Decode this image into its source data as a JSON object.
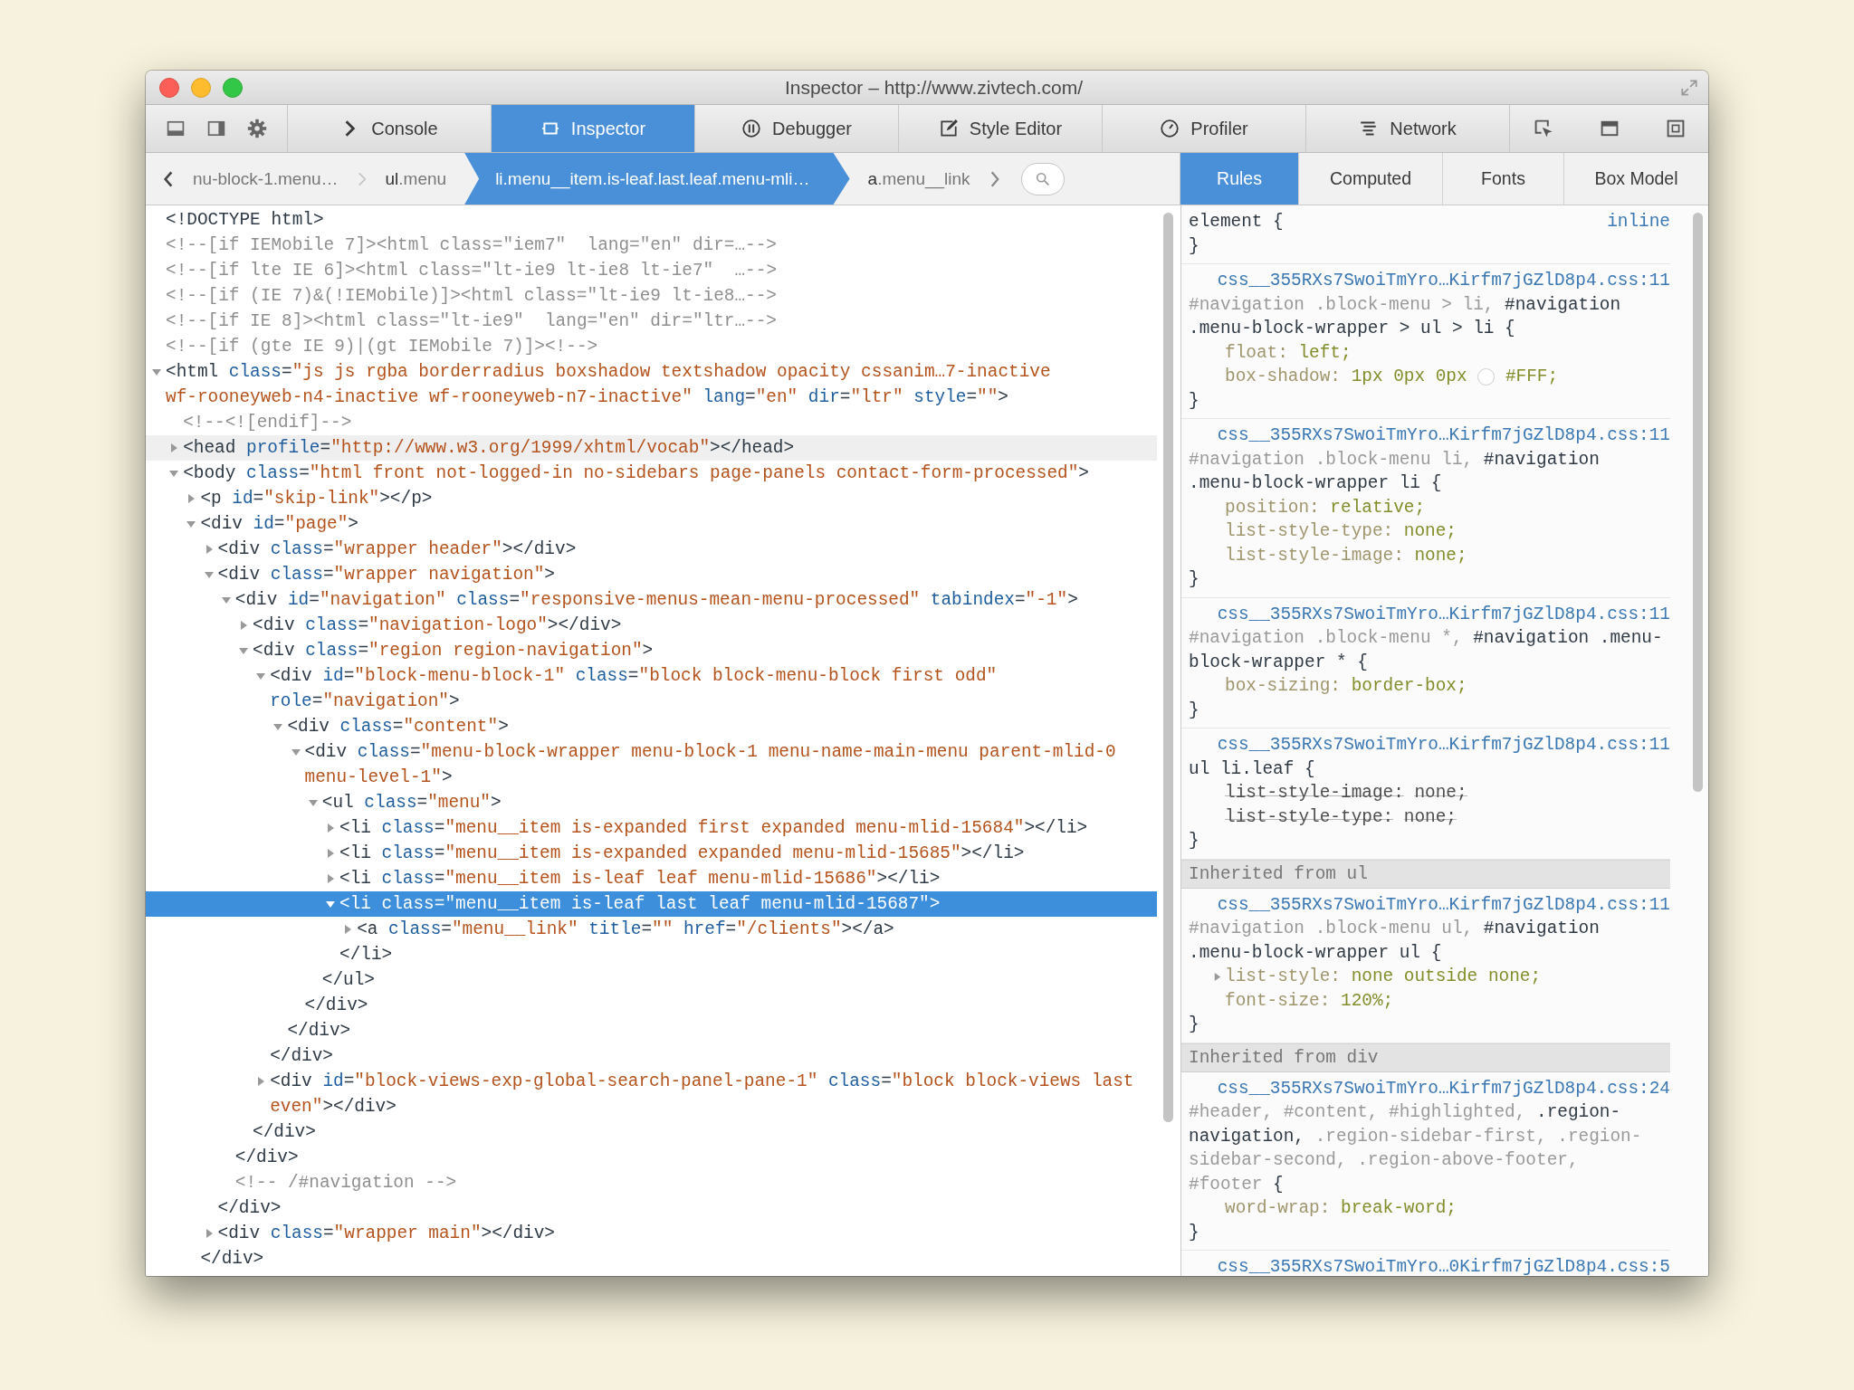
{
  "window": {
    "title": "Inspector – http://www.zivtech.com/"
  },
  "toolbar": {
    "tabs": [
      {
        "label": "Console",
        "selected": false
      },
      {
        "label": "Inspector",
        "selected": true
      },
      {
        "label": "Debugger",
        "selected": false
      },
      {
        "label": "Style Editor",
        "selected": false
      },
      {
        "label": "Profiler",
        "selected": false
      },
      {
        "label": "Network",
        "selected": false
      }
    ]
  },
  "breadcrumbs": [
    {
      "classes": "nu-block-1.menu…",
      "selected": false
    },
    {
      "tag": "ul",
      "classes": ".menu",
      "selected": false
    },
    {
      "tag": "li",
      "classes": ".menu__item.is-leaf.last.leaf.menu-mli…",
      "selected": true
    },
    {
      "tag": "a",
      "classes": ".menu__link",
      "selected": false
    }
  ],
  "side_tabs": [
    {
      "label": "Rules",
      "selected": true
    },
    {
      "label": "Computed",
      "selected": false
    },
    {
      "label": "Fonts",
      "selected": false
    },
    {
      "label": "Box Model",
      "selected": false
    }
  ],
  "markup": [
    {
      "kind": "doctype",
      "text": "<!DOCTYPE html>",
      "selected": false,
      "hovered": false
    },
    {
      "kind": "comment",
      "text": "<!--[if IEMobile 7]><html class=\"iem7\"  lang=\"en\" dir=…-->",
      "selected": false,
      "hovered": false
    },
    {
      "kind": "comment",
      "text": "<!--[if lte IE 6]><html class=\"lt-ie9 lt-ie8 lt-ie7\"  …-->",
      "selected": false,
      "hovered": false
    },
    {
      "kind": "comment",
      "text": "<!--[if (IE 7)&(!IEMobile)]><html class=\"lt-ie9 lt-ie8…-->",
      "selected": false,
      "hovered": false
    },
    {
      "kind": "comment",
      "text": "<!--[if IE 8]><html class=\"lt-ie9\"  lang=\"en\" dir=\"ltr…-->",
      "selected": false,
      "hovered": false
    },
    {
      "kind": "comment",
      "text": "<!--[if (gte IE 9)|(gt IEMobile 7)]><!-->",
      "selected": false,
      "hovered": false
    },
    {
      "kind": "element",
      "text": "<html class=\"js js rgba borderradius boxshadow textshadow opacity cssanim…7-inactive wf-rooneyweb-n4-inactive wf-rooneyweb-n7-inactive\" lang=\"en\" dir=\"ltr\" style=\"\">",
      "expanded": true,
      "selected": false,
      "hovered": false,
      "children": [
        {
          "kind": "comment",
          "text": "<!--<![endif]-->",
          "selected": false,
          "hovered": false
        },
        {
          "kind": "element",
          "text": "<head profile=\"http://www.w3.org/1999/xhtml/vocab\"></head>",
          "expanded": false,
          "selected": false,
          "hovered": true
        },
        {
          "kind": "element",
          "text": "<body class=\"html front not-logged-in no-sidebars page-panels contact-form-processed\">",
          "expanded": true,
          "selected": false,
          "hovered": false,
          "children": [
            {
              "kind": "element",
              "text": "<p id=\"skip-link\"></p>",
              "expanded": false,
              "selected": false,
              "hovered": false
            },
            {
              "kind": "element",
              "text": "<div id=\"page\">",
              "expanded": true,
              "selected": false,
              "hovered": false,
              "close": "</div>",
              "children": [
                {
                  "kind": "element",
                  "text": "<div class=\"wrapper header\"></div>",
                  "expanded": false,
                  "selected": false,
                  "hovered": false
                },
                {
                  "kind": "element",
                  "text": "<div class=\"wrapper navigation\">",
                  "expanded": true,
                  "selected": false,
                  "hovered": false,
                  "close": "</div>",
                  "children": [
                    {
                      "kind": "element",
                      "text": "<div id=\"navigation\" class=\"responsive-menus-mean-menu-processed\" tabindex=\"-1\">",
                      "expanded": true,
                      "selected": false,
                      "hovered": false,
                      "close": "</div>",
                      "children": [
                        {
                          "kind": "element",
                          "text": "<div class=\"navigation-logo\"></div>",
                          "expanded": false,
                          "selected": false,
                          "hovered": false
                        },
                        {
                          "kind": "element",
                          "text": "<div class=\"region region-navigation\">",
                          "expanded": true,
                          "selected": false,
                          "hovered": false,
                          "close": "</div>",
                          "children": [
                            {
                              "kind": "element",
                              "text": "<div id=\"block-menu-block-1\" class=\"block block-menu-block first odd\" role=\"navigation\">",
                              "expanded": true,
                              "selected": false,
                              "hovered": false,
                              "close": "</div>",
                              "children": [
                                {
                                  "kind": "element",
                                  "text": "<div class=\"content\">",
                                  "expanded": true,
                                  "selected": false,
                                  "hovered": false,
                                  "close": "</div>",
                                  "children": [
                                    {
                                      "kind": "element",
                                      "text": "<div class=\"menu-block-wrapper menu-block-1 menu-name-main-menu parent-mlid-0 menu-level-1\">",
                                      "expanded": true,
                                      "selected": false,
                                      "hovered": false,
                                      "close": "</div>",
                                      "children": [
                                        {
                                          "kind": "element",
                                          "text": "<ul class=\"menu\">",
                                          "expanded": true,
                                          "selected": false,
                                          "hovered": false,
                                          "close": "</ul>",
                                          "children": [
                                            {
                                              "kind": "element",
                                              "text": "<li class=\"menu__item is-expanded first expanded menu-mlid-15684\"></li>",
                                              "expanded": false,
                                              "selected": false,
                                              "hovered": false
                                            },
                                            {
                                              "kind": "element",
                                              "text": "<li class=\"menu__item is-expanded expanded menu-mlid-15685\"></li>",
                                              "expanded": false,
                                              "selected": false,
                                              "hovered": false
                                            },
                                            {
                                              "kind": "element",
                                              "text": "<li class=\"menu__item is-leaf leaf menu-mlid-15686\"></li>",
                                              "expanded": false,
                                              "selected": false,
                                              "hovered": false
                                            },
                                            {
                                              "kind": "element",
                                              "text": "<li class=\"menu__item is-leaf last leaf menu-mlid-15687\">",
                                              "expanded": true,
                                              "selected": true,
                                              "hovered": false,
                                              "close": "</li>",
                                              "children": [
                                                {
                                                  "kind": "element",
                                                  "text": "<a class=\"menu__link\" title=\"\" href=\"/clients\"></a>",
                                                  "expanded": false,
                                                  "selected": false,
                                                  "hovered": false
                                                }
                                              ]
                                            }
                                          ]
                                        }
                                      ]
                                    }
                                  ]
                                }
                              ]
                            },
                            {
                              "kind": "element",
                              "text": "<div id=\"block-views-exp-global-search-panel-pane-1\" class=\"block block-views last even\"></div>",
                              "expanded": false,
                              "selected": false,
                              "hovered": false
                            }
                          ]
                        }
                      ]
                    },
                    {
                      "kind": "comment",
                      "text": "<!-- /#navigation -->",
                      "selected": false,
                      "hovered": false
                    }
                  ]
                },
                {
                  "kind": "element",
                  "text": "<div class=\"wrapper main\"></div>",
                  "expanded": false,
                  "selected": false,
                  "hovered": false
                }
              ]
            }
          ]
        }
      ]
    }
  ],
  "rules": [
    {
      "kind": "element",
      "selector": "element",
      "open": "{",
      "close": "}",
      "source": "inline"
    },
    {
      "kind": "rule",
      "source": "css__355RXs7SwoiTmYro…Kirfm7jGZlD8p4.css:11",
      "open": "{",
      "close": "}",
      "selector": [
        {
          "text": "#navigation .block-menu > li,",
          "matched": false
        },
        {
          "text": "#navigation .menu-block-wrapper > ul > li",
          "matched": true
        }
      ],
      "declarations": [
        {
          "property": "float:",
          "value": "left;",
          "expandable": false,
          "overridden": false
        },
        {
          "property": "box-shadow:",
          "value": "1px 0px 0px",
          "color": "#ffffff",
          "color_value": "#FFF;",
          "expandable": false,
          "overridden": false
        }
      ]
    },
    {
      "kind": "rule",
      "source": "css__355RXs7SwoiTmYro…Kirfm7jGZlD8p4.css:11",
      "open": "{",
      "close": "}",
      "selector": [
        {
          "text": "#navigation .block-menu li,",
          "matched": false
        },
        {
          "text": "#navigation .menu-block-wrapper li",
          "matched": true
        }
      ],
      "declarations": [
        {
          "property": "position:",
          "value": "relative;",
          "expandable": false,
          "overridden": false
        },
        {
          "property": "list-style-type:",
          "value": "none;",
          "expandable": false,
          "overridden": false
        },
        {
          "property": "list-style-image:",
          "value": "none;",
          "expandable": false,
          "overridden": false
        }
      ]
    },
    {
      "kind": "rule",
      "source": "css__355RXs7SwoiTmYro…Kirfm7jGZlD8p4.css:11",
      "open": "{",
      "close": "}",
      "selector": [
        {
          "text": "#navigation .block-menu *,",
          "matched": false
        },
        {
          "text": "#navigation .menu-block-wrapper *",
          "matched": true
        }
      ],
      "declarations": [
        {
          "property": "box-sizing:",
          "value": "border-box;",
          "expandable": false,
          "overridden": false
        }
      ]
    },
    {
      "kind": "rule",
      "source": "css__355RXs7SwoiTmYro…Kirfm7jGZlD8p4.css:11",
      "open": "{",
      "close": "}",
      "selector": [
        {
          "text": "ul li.leaf",
          "matched": true
        }
      ],
      "declarations": [
        {
          "property": "list-style-image:",
          "value": "none;",
          "expandable": false,
          "overridden": true
        },
        {
          "property": "list-style-type:",
          "value": "none;",
          "expandable": false,
          "overridden": true
        }
      ]
    },
    {
      "kind": "header",
      "label": "Inherited from ul"
    },
    {
      "kind": "rule",
      "source": "css__355RXs7SwoiTmYro…Kirfm7jGZlD8p4.css:11",
      "open": "{",
      "close": "}",
      "selector": [
        {
          "text": "#navigation .block-menu ul,",
          "matched": false
        },
        {
          "text": "#navigation .menu-block-wrapper ul",
          "matched": true
        }
      ],
      "declarations": [
        {
          "property": "list-style:",
          "value": "none outside none;",
          "expandable": true,
          "overridden": false
        },
        {
          "property": "font-size:",
          "value": "120%;",
          "expandable": false,
          "overridden": false
        }
      ]
    },
    {
      "kind": "header",
      "label": "Inherited from div"
    },
    {
      "kind": "rule",
      "source": "css__355RXs7SwoiTmYro…Kirfm7jGZlD8p4.css:24",
      "open": "{",
      "close": "}",
      "selector": [
        {
          "text": "#header, #content, #highlighted,",
          "matched": false
        },
        {
          "text": ".region-navigation,",
          "matched": true
        },
        {
          "text": ".region-sidebar-first, .region-sidebar-second, .region-above-footer, #footer",
          "matched": false
        }
      ],
      "declarations": [
        {
          "property": "word-wrap:",
          "value": "break-word;",
          "expandable": false,
          "overridden": false
        }
      ]
    },
    {
      "kind": "rule",
      "source": "css__355RXs7SwoiTmYro…0Kirfm7jGZlD8p4.css:5"
    }
  ]
}
